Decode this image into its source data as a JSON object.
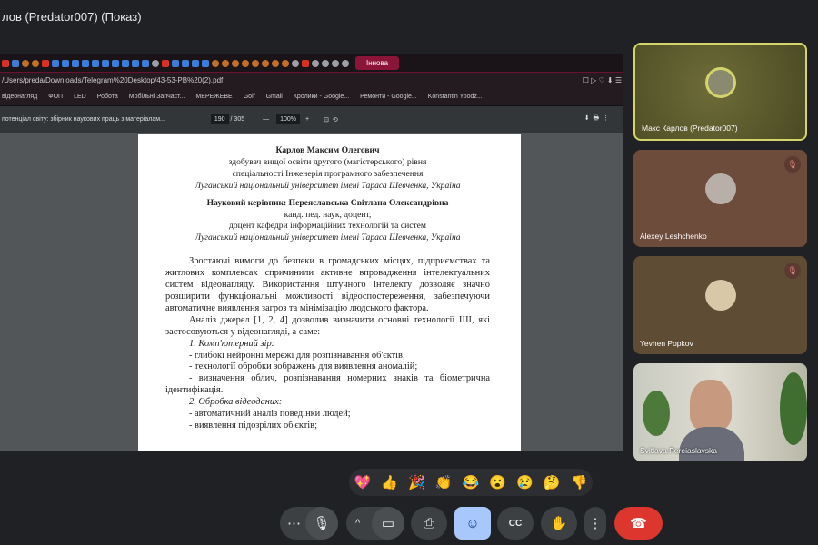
{
  "window_title": "лов (Predator007) (Показ)",
  "browser": {
    "active_tab": "Іннова",
    "url": "/Users/preda/Downloads/Telegram%20Desktop/43-53-PB%20(2).pdf",
    "bookmarks": [
      "відеонагляд",
      "ФОП",
      "LED",
      "Робота",
      "Мобільні Запчаст...",
      "МЕРЕЖЕВЕ",
      "Golf",
      "Gmail",
      "Кролики - Google...",
      "Ремонти - Google...",
      "Konstantin Yoodz..."
    ]
  },
  "pdf": {
    "title": "потенціал світу: збірник наукових праць з матеріалам...",
    "page": "190",
    "total": "/ 305",
    "zoom": "100%",
    "lines": {
      "author": "Карлов Максим Олегович",
      "a1": "здобувач вищої освіти другого (магістерського) рівня",
      "a2": "спеціальності Інженерія програмного забезпечення",
      "a3": "Луганський національний університет імені Тараса Шевченка, Україна",
      "sup": "Науковий керівник: Переяславська Світлана Олександрівна",
      "s1": "канд. пед. наук, доцент,",
      "s2": "доцент кафедри інформаційних технологій та систем",
      "s3": "Луганський національний університет імені Тараса Шевченка, Україна",
      "p1": "Зростаючі вимоги до безпеки в громадських місцях, підприємствах та житлових комплексах спричинили активне впровадження інтелектуальних систем відеонагляду. Використання штучного інтелекту дозволяє значно розширити функціональні можливості відеоспостереження, забезпечуючи автоматичне виявлення загроз та мінімізацію людського фактора.",
      "p2": "Аналіз джерел [1, 2, 4] дозволив визначити основні технології ШІ, які застосовуються у відеонагляді, а саме:",
      "h1": "1. Комп'ютерний зір:",
      "l1": "-  глибокі нейронні мережі для розпізнавання об'єктів;",
      "l2": "-  технології обробки зображень для виявлення аномалій;",
      "l3": "- визначення облич, розпізнавання номерних знаків та біометрична ідентифікація.",
      "h2": "2. Обробка відеоданих:",
      "l4": "-  автоматичний аналіз поведінки людей;",
      "l5": "-  виявлення підозрілих об'єктів;"
    }
  },
  "participants": [
    {
      "name": "Макс Карлов (Predator007)",
      "speaking": true,
      "muted": false
    },
    {
      "name": "Alexey Leshchenko",
      "muted": true
    },
    {
      "name": "Yevhen Popkov",
      "muted": true
    },
    {
      "name": "Svitlava Pereiaslavska",
      "video": true
    }
  ],
  "reactions": [
    "💖",
    "👍",
    "🎉",
    "👏",
    "😂",
    "😮",
    "😢",
    "🤔",
    "👎"
  ],
  "controls": {
    "more": "⋯",
    "mic": "🎤",
    "chevron": "^",
    "camera": "📹",
    "present": "⬆",
    "emoji": "☺",
    "captions": "CC",
    "hand": "✋",
    "options": "⋮",
    "end": "☎"
  },
  "colors": {
    "accent": "#a8c7fa",
    "end_call": "#dc362e",
    "speaking_border": "#d4d46a"
  }
}
